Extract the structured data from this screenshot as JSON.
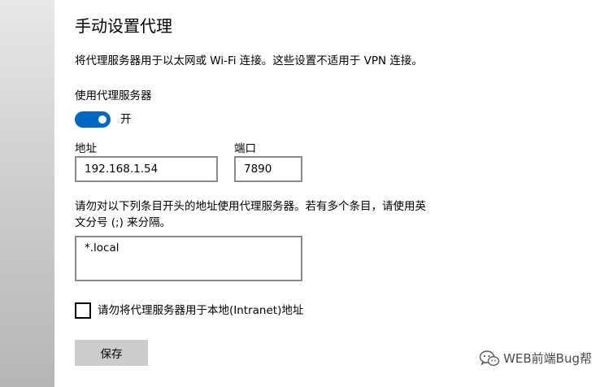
{
  "page": {
    "title": "手动设置代理",
    "description": "将代理服务器用于以太网或 Wi-Fi 连接。这些设置不适用于 VPN 连接。"
  },
  "proxy_toggle": {
    "label": "使用代理服务器",
    "on": true,
    "state_text": "开",
    "accent_color": "#0067c0"
  },
  "address": {
    "label": "地址",
    "value": "192.168.1.54"
  },
  "port": {
    "label": "端口",
    "value": "7890"
  },
  "exceptions": {
    "label_line1": "请勿对以下列条目开头的地址使用代理服务器。若有多个条目，请使用英",
    "label_line2": "文分号 (;) 来分隔。",
    "value": "*.local"
  },
  "local_bypass": {
    "label": "请勿将代理服务器用于本地(Intranet)地址",
    "checked": false
  },
  "save_button": {
    "label": "保存"
  },
  "watermark": {
    "text": "WEB前端Bug帮",
    "icon": "wechat-icon"
  }
}
